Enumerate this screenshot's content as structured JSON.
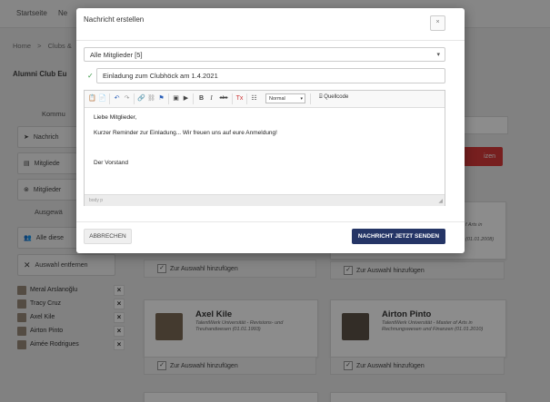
{
  "colors": {
    "primary_button": "#253566",
    "danger_button": "#d93a3a",
    "check_green": "#3c9a47",
    "overlay": "rgba(0,0,0,0.45)"
  },
  "background": {
    "nav": {
      "item1": "Startseite",
      "item2": "Ne"
    },
    "breadcrumb": {
      "home": "Home",
      "sep": ">",
      "current": "Clubs &"
    },
    "club_title": "Alumni Club Eu",
    "sidebar": {
      "kommunikation_heading": "Kommu",
      "btn_nachricht": "Nachrich",
      "btn_mitglieder1": "Mitgliede",
      "btn_mitglieder2": "Mitglieder",
      "ausgewaehlt_heading": "Ausgewä",
      "btn_alle": "Alle diese",
      "btn_auswahl_entfernen": "Auswahl entfernen"
    },
    "selected_members": [
      "Meral Arslanoğlu",
      "Tracy Cruz",
      "Axel Kile",
      "Airton Pinto",
      "Aimée Rodrigues"
    ],
    "red_button": "izen",
    "cards": [
      {
        "name": "Axel Kile",
        "info_line1": "TalentWerk Universität - Revisions- und",
        "info_line2": "Treuhandwesen (01.01.1993)",
        "add_label": "Zur Auswahl hinzufügen"
      },
      {
        "name": "Airton Pinto",
        "info_line1": "TalentWerk Universität - Master of Arts in",
        "info_line2": "Rechnungswesen und Finanzen (01.01.2010)",
        "add_label": "Zur Auswahl hinzufügen"
      }
    ],
    "top_card_add_left": "Zur Auswahl hinzufügen",
    "top_card_add_right": "Zur Auswahl hinzufügen",
    "frag_arts": "f Arts in",
    "frag_date": "(01.01.2008)"
  },
  "modal": {
    "title": "Nachricht erstellen",
    "close_symbol": "×",
    "recipient": "Alle Mitglieder [5]",
    "subject": "Einladung zum Clubhöck am 1.4.2021",
    "toolbar": {
      "format_value": "Normal",
      "source_label": "Quellcode",
      "bold": "B",
      "italic": "I",
      "strike": "abc"
    },
    "body_lines": [
      "Liebe Mitglieder,",
      "Kurzer Reminder zur Einladung... Wir freuen uns auf eure Anmeldung!",
      "",
      "Der Vorstand"
    ],
    "status_path": "body  p",
    "cancel_label": "ABBRECHEN",
    "send_label": "NACHRICHT JETZT SENDEN"
  }
}
